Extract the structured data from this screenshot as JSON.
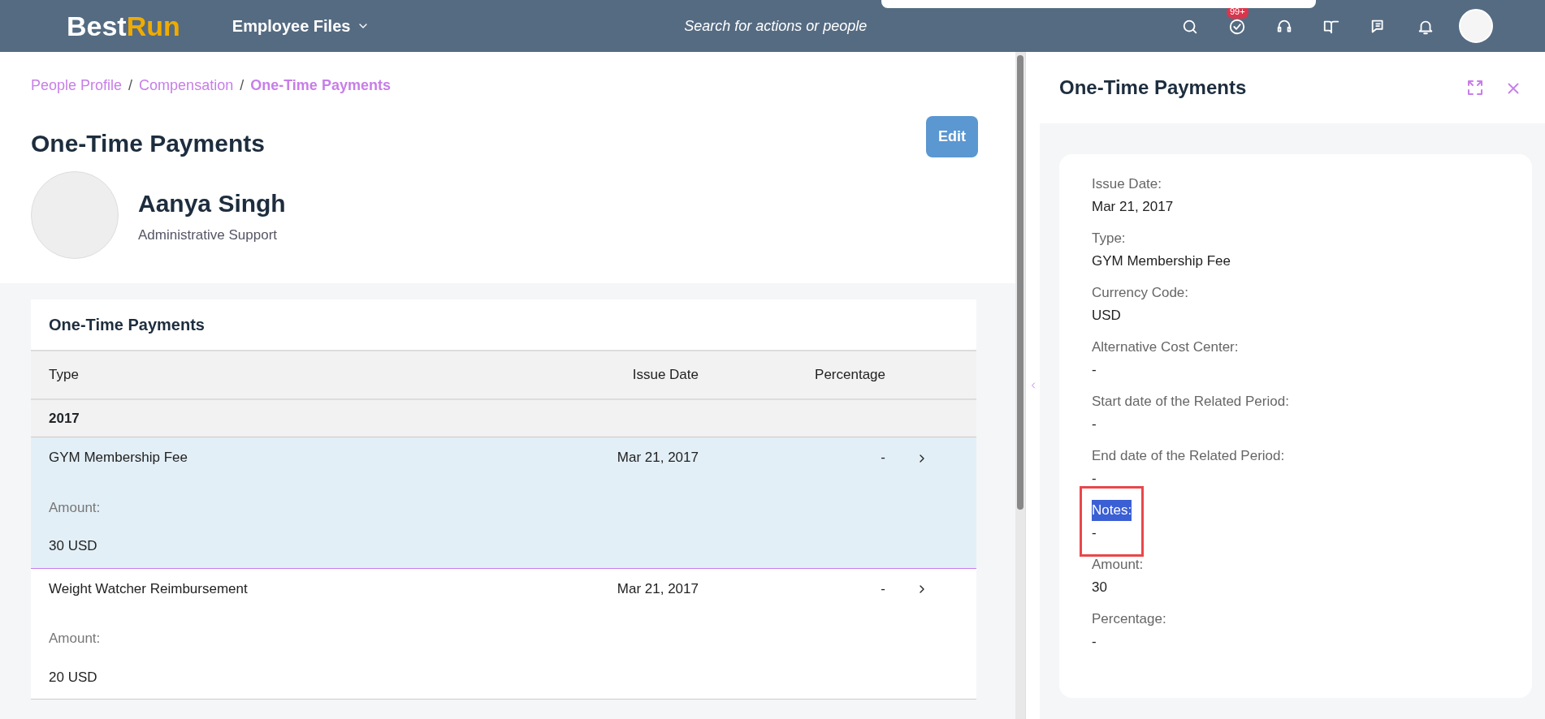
{
  "header": {
    "logo": {
      "first": "Best",
      "second": "Run"
    },
    "app_menu": "Employee Files",
    "search": {
      "placeholder": "Search for actions or people"
    },
    "actions": [
      {
        "kind": "search"
      },
      {
        "kind": "todo",
        "badge": "99+"
      },
      {
        "kind": "support"
      },
      {
        "kind": "learning"
      },
      {
        "kind": "chat"
      },
      {
        "kind": "bell"
      },
      {
        "kind": "avatar"
      }
    ]
  },
  "breadcrumb_separator": "/",
  "breadcrumbs": [
    {
      "label": "People Profile",
      "current": false
    },
    {
      "label": "Compensation",
      "current": false
    },
    {
      "label": "One-Time Payments",
      "current": true
    }
  ],
  "page": {
    "title": "One-Time Payments",
    "edit_button": "Edit",
    "person": {
      "name": "Aanya Singh",
      "role": "Administrative Support"
    }
  },
  "table": {
    "title": "One-Time Payments",
    "columns": [
      "Type",
      "Issue Date",
      "Percentage"
    ],
    "groups": [
      {
        "label": "2017",
        "rows": [
          {
            "type": "GYM Membership Fee",
            "issue_date": "Mar 21, 2017",
            "percentage": "-",
            "detail_label": "Amount:",
            "detail_value": "30 USD",
            "selected": true
          },
          {
            "type": "Weight Watcher Reimbursement",
            "issue_date": "Mar 21, 2017",
            "percentage": "-",
            "detail_label": "Amount:",
            "detail_value": "20 USD",
            "selected": false
          }
        ]
      }
    ]
  },
  "detail_panel": {
    "title": "One-Time Payments",
    "fields": [
      {
        "label": "Issue Date:",
        "value": "Mar 21, 2017",
        "annotated": false
      },
      {
        "label": "Type:",
        "value": "GYM Membership Fee",
        "annotated": false
      },
      {
        "label": "Currency Code:",
        "value": "USD",
        "annotated": false
      },
      {
        "label": "Alternative Cost Center:",
        "value": "-",
        "annotated": false
      },
      {
        "label": "Start date of the Related Period:",
        "value": "-",
        "annotated": false
      },
      {
        "label": "End date of the Related Period:",
        "value": "-",
        "annotated": false
      },
      {
        "label": "Notes:",
        "value": "-",
        "annotated": true
      },
      {
        "label": "Amount:",
        "value": "30",
        "annotated": false
      },
      {
        "label": "Percentage:",
        "value": "-",
        "annotated": false
      }
    ]
  }
}
